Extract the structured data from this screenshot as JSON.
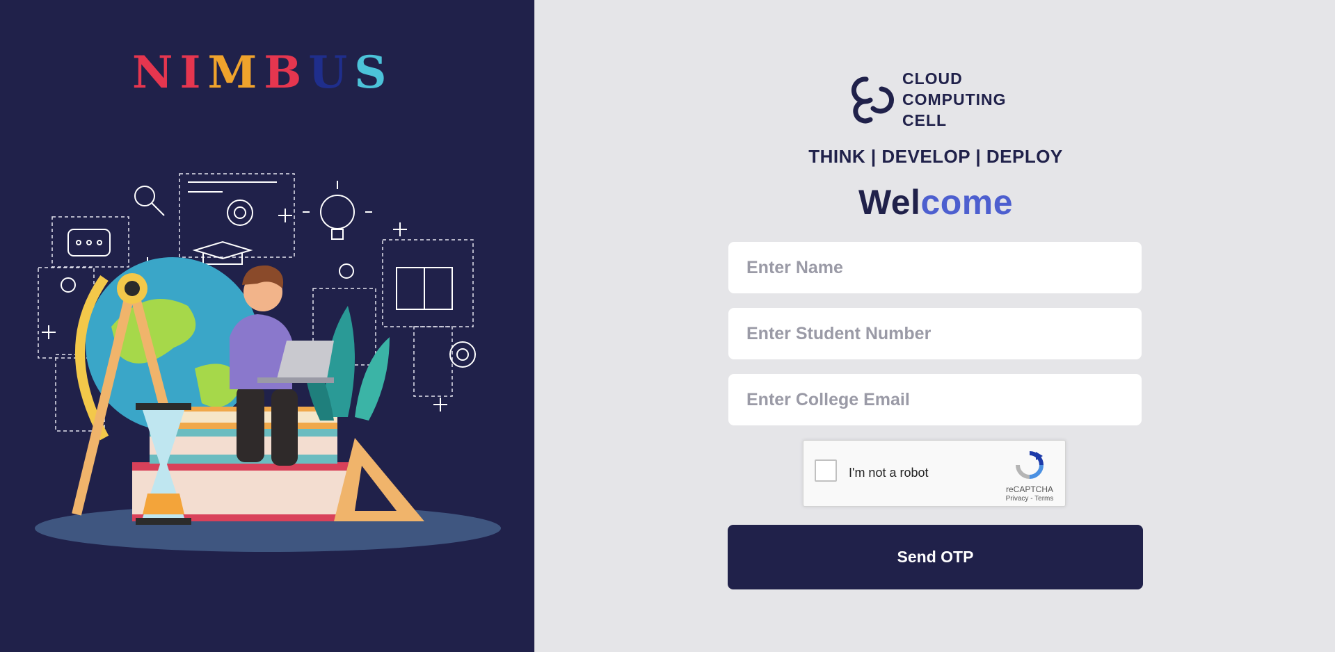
{
  "brand": {
    "logo_letters": [
      "N",
      "I",
      "M",
      "B",
      "U",
      "S"
    ],
    "logo_colors": [
      "#e5364f",
      "#f0a32c",
      "#f4b41a",
      "#4cc3d9",
      "#1f2e8c",
      "#e53d7e"
    ]
  },
  "org": {
    "name_lines": [
      "CLOUD",
      "COMPUTING",
      "CELL"
    ],
    "tagline": "THINK | DEVELOP | DEPLOY"
  },
  "welcome": {
    "part1": "Wel",
    "part2": "come"
  },
  "form": {
    "name_placeholder": "Enter Name",
    "student_number_placeholder": "Enter Student Number",
    "email_placeholder": "Enter College Email",
    "submit_label": "Send OTP"
  },
  "recaptcha": {
    "label": "I'm not a robot",
    "brand": "reCAPTCHA",
    "links": "Privacy - Terms"
  },
  "colors": {
    "left_bg": "#20214a",
    "right_bg": "#e5e5e8",
    "accent_dark": "#20214a",
    "accent_blue": "#4d5fcf"
  },
  "icons": [
    "ccc-logo-icon",
    "recaptcha-icon",
    "checkbox-icon"
  ]
}
